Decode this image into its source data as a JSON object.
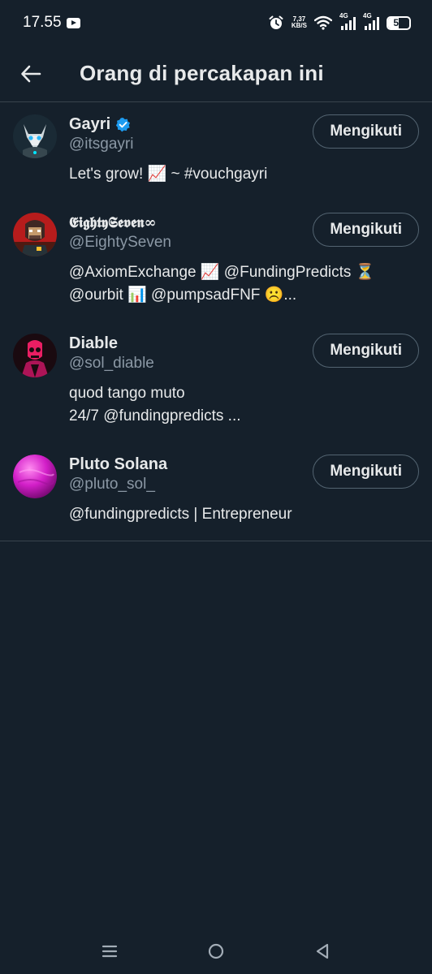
{
  "status_bar": {
    "time": "17.55",
    "net_speed_value": "7,37",
    "net_speed_unit": "KB/S",
    "signal_1_label": "4G",
    "signal_2_label": "4G",
    "battery_level": "50"
  },
  "header": {
    "title": "Orang di percakapan ini"
  },
  "users": [
    {
      "name": "Gayri",
      "verified": true,
      "handle": "@itsgayri",
      "bio": "Let's grow! 📈 ~ #vouchgayri",
      "follow_label": "Mengikuti"
    },
    {
      "name": "𝕰𝖎𝖌𝖍𝖙𝖞𝕾𝖊𝖛𝖊𝖓∞",
      "verified": false,
      "handle": "@EightySeven",
      "bio": "@AxiomExchange 📈 @FundingPredicts ⏳\n@ourbit 📊 @pumpsadFNF ☹️...",
      "follow_label": "Mengikuti"
    },
    {
      "name": "Diable",
      "verified": false,
      "handle": "@sol_diable",
      "bio": "quod tango muto\n24/7 @fundingpredicts ...",
      "follow_label": "Mengikuti"
    },
    {
      "name": "Pluto Solana",
      "verified": false,
      "handle": "@pluto_sol_",
      "bio": "@fundingpredicts | Entrepreneur",
      "follow_label": "Mengikuti"
    }
  ],
  "colors": {
    "background": "#15202b",
    "text_primary": "#e7e9ea",
    "text_secondary": "#8b98a5",
    "divider": "#38444d",
    "verified_blue": "#1d9bf0"
  },
  "icons": {
    "back": "arrow-left-icon",
    "verified": "verified-badge-icon",
    "nav_menu": "recent-apps-icon",
    "nav_home": "home-circle-icon",
    "nav_back": "back-triangle-icon"
  }
}
